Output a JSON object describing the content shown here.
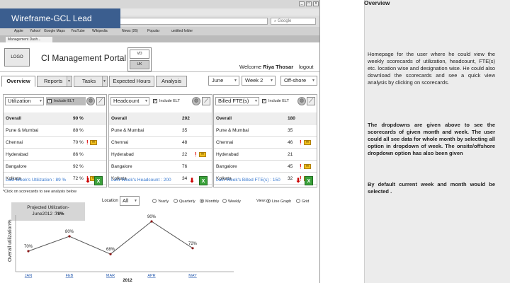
{
  "banner": "Wireframe-GCL Lead",
  "browser": {
    "menu": "File  Edit  View  History  Bookmarks  Window  Help",
    "search_placeholder": "Google",
    "bookmarks": [
      "Apple",
      "Yahoo!",
      "Google Maps",
      "YouTube",
      "Wikipedia",
      "News (26)",
      "Popular",
      "untitled folder"
    ],
    "tab_label": "Management Dash..."
  },
  "header": {
    "logo": "LOGO",
    "title": "CI Management Portal",
    "region_vd": "VD",
    "region_uk": "UK",
    "welcome_prefix": "Welcome",
    "user": "Riya Thosar",
    "logout": "logout"
  },
  "tabs": [
    "Overview",
    "Reports",
    "Tasks",
    "Expected Hours",
    "Analysis"
  ],
  "filters": {
    "month": "June",
    "week": "Week 2",
    "location": "Off-shore"
  },
  "include_elt": "Include ELT",
  "scorecards": [
    {
      "select": "Utilization",
      "rows": [
        {
          "name": "Overall",
          "value": "90 %"
        },
        {
          "name": "Pune & Mumbai",
          "value": "88 %"
        },
        {
          "name": "Chennai",
          "value": "70 %"
        },
        {
          "name": "Hyderabad",
          "value": "86 %"
        },
        {
          "name": "Bangalore",
          "value": "92 %"
        },
        {
          "name": "Kolkata",
          "value": "72 %"
        }
      ],
      "last_week": "Last Week's Utilization : 89 %"
    },
    {
      "select": "Headcount",
      "rows": [
        {
          "name": "Overall",
          "value": "202"
        },
        {
          "name": "Pune & Mumbai",
          "value": "35"
        },
        {
          "name": "Chennai",
          "value": "48"
        },
        {
          "name": "Hyderabad",
          "value": "22"
        },
        {
          "name": "Bangalore",
          "value": "76"
        },
        {
          "name": "Kolkata",
          "value": "34"
        }
      ],
      "last_week": "Last Week's Headcount : 200"
    },
    {
      "select": "Billed FTE(s)",
      "rows": [
        {
          "name": "Overall",
          "value": "180"
        },
        {
          "name": "Pune & Mumbai",
          "value": "35"
        },
        {
          "name": "Chennai",
          "value": "46"
        },
        {
          "name": "Hyderabad",
          "value": "21"
        },
        {
          "name": "Bangalore",
          "value": "45"
        },
        {
          "name": "Kolkata",
          "value": "32"
        }
      ],
      "last_week": "Last Week's Billed FTE(s) : 150"
    }
  ],
  "click_note": "*Click on scorecards to see analysis below",
  "projection": {
    "line1": "Projected Utilization-",
    "line2a": "June2012 :",
    "line2b": "78%"
  },
  "analysis": {
    "location_label": "Location",
    "location_value": "All",
    "periods": [
      "Yearly",
      "Quarterly",
      "Monthly",
      "Weekly"
    ],
    "view_label": "View:",
    "views": [
      "Line Graph",
      "Grid"
    ]
  },
  "chart_data": {
    "type": "line",
    "categories": [
      "JAN",
      "FEB",
      "MAR",
      "APR",
      "MAY"
    ],
    "values": [
      70,
      80,
      68,
      90,
      72
    ],
    "data_labels": [
      "70%",
      "80%",
      "68%",
      "90%",
      "72%"
    ],
    "ylabel": "Overall utilization%",
    "xlabel": "2012",
    "color": "#555555",
    "marker_color": "#8b1a1a"
  },
  "sidebar": {
    "title": "Overview",
    "p1": "Homepage for the user where he could view the weekly scorecards of utilization, headcount, FTE(s) etc. location wise and designation wise. He could also download the scorecards and see a quick view analysis by clicking on scorecards.",
    "p2": "The dropdowns are given above to see the scorecards of given month and week. The user could all see data for whole month by selecting all option in dropdown of week. The onsite/offshore dropdown option has also been given",
    "p3": "By default current week and month would be selected ."
  }
}
